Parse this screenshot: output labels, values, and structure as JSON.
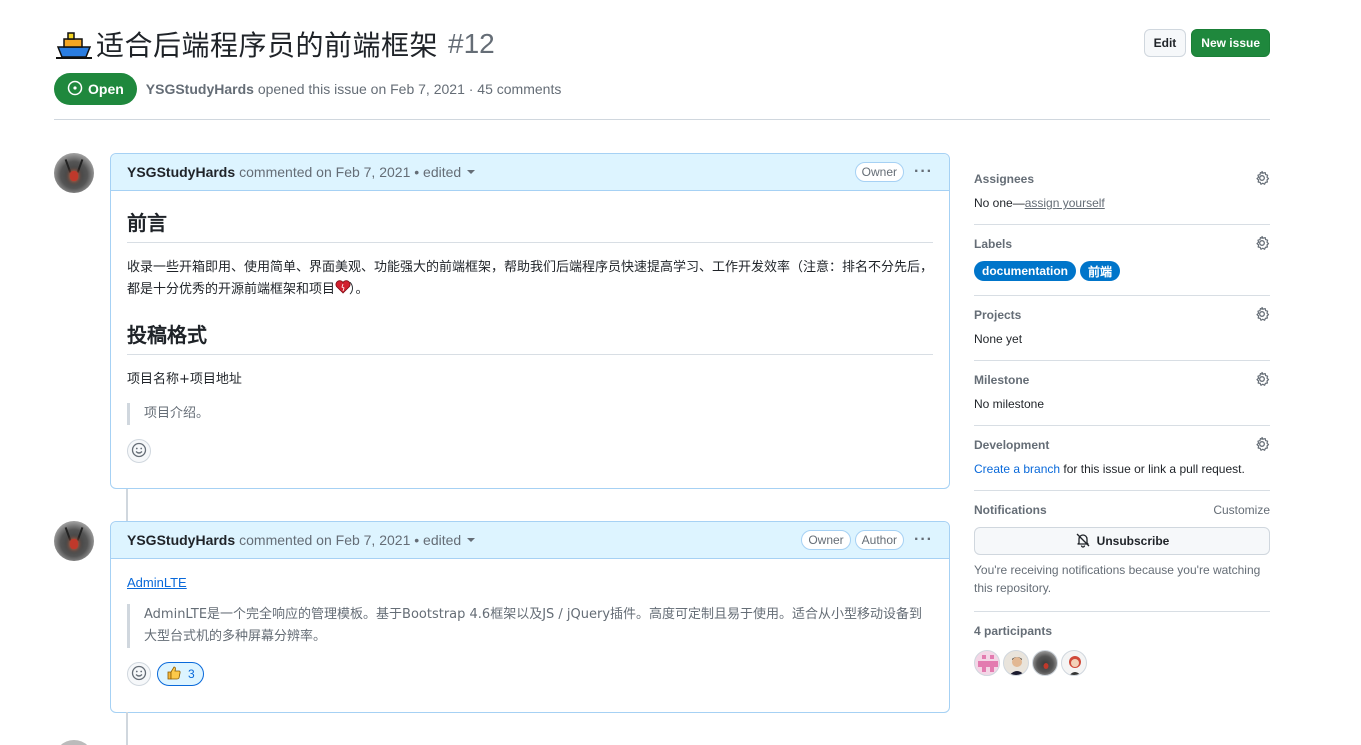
{
  "issue": {
    "title": "适合后端程序员的前端框架",
    "number": "#12",
    "state": "Open",
    "author": "YSGStudyHards",
    "meta": "opened this issue on Feb 7, 2021 · 45 comments"
  },
  "header_buttons": {
    "edit": "Edit",
    "new_issue": "New issue"
  },
  "comments": [
    {
      "author": "YSGStudyHards",
      "meta": "commented on Feb 7, 2021 • edited",
      "badges": [
        "Owner"
      ],
      "heading1": "前言",
      "paragraph": "收录一些开箱即用、使用简单、界面美观、功能强大的前端框架，帮助我们后端程序员快速提高学习、工作开发效率（注意：排名不分先后，都是十分优秀的开源前端框架和项目",
      "paragraph_end": "）。",
      "heading2": "投稿格式",
      "format_line": "项目名称+项目地址",
      "quote": "项目介绍。"
    },
    {
      "author": "YSGStudyHards",
      "meta": "commented on Feb 7, 2021 • edited",
      "badges": [
        "Owner",
        "Author"
      ],
      "link": "AdminLTE",
      "quote": "AdminLTE是一个完全响应的管理模板。基于Bootstrap 4.6框架以及JS / jQuery插件。高度可定制且易于使用。适合从小型移动设备到大型台式机的多种屏幕分辨率。",
      "reaction_count": "3"
    }
  ],
  "sidebar": {
    "assignees": {
      "title": "Assignees",
      "value": "No one—",
      "link": "assign yourself"
    },
    "labels": {
      "title": "Labels",
      "items": [
        "documentation",
        "前端"
      ]
    },
    "projects": {
      "title": "Projects",
      "value": "None yet"
    },
    "milestone": {
      "title": "Milestone",
      "value": "No milestone"
    },
    "development": {
      "title": "Development",
      "link": "Create a branch",
      "value": " for this issue or link a pull request."
    },
    "notifications": {
      "title": "Notifications",
      "customize": "Customize",
      "button": "Unsubscribe",
      "note": "You're receiving notifications because you're watching this repository."
    },
    "participants": {
      "title": "4 participants"
    }
  },
  "colors": {
    "accent": "#0969da",
    "open": "#1f883d",
    "label": "#0075ca",
    "comment_header": "#ddf4ff"
  }
}
